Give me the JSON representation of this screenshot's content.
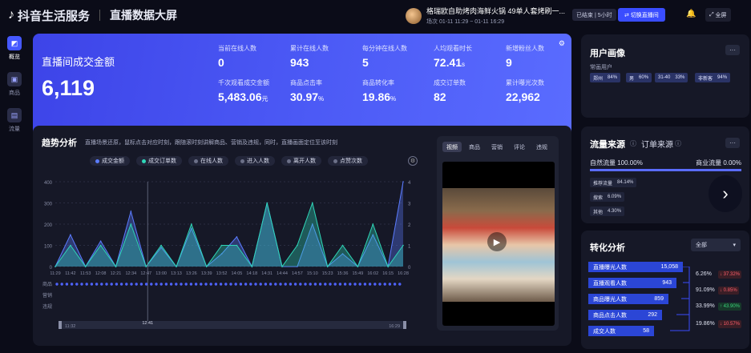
{
  "app": {
    "name": "抖音生活服务",
    "page_title": "直播数据大屏"
  },
  "room": {
    "name": "格瑞欧自助烤肉海鲜火锅 49单人套烤刷一...",
    "time": "场次 01-11 11:29 ~ 01-11 16:29"
  },
  "header": {
    "status": "已结束 | 5小时",
    "switch_label": "切换直播间",
    "fullscreen_label": "全屏"
  },
  "sidebar": {
    "items": [
      {
        "label": "概览",
        "icon": "chart-icon"
      },
      {
        "label": "商品",
        "icon": "bag-icon"
      },
      {
        "label": "流量",
        "icon": "flow-icon"
      }
    ]
  },
  "kpi": {
    "main_label": "直播间成交金额",
    "main_value": "6,119",
    "cells": [
      {
        "label": "当前在线人数",
        "value": "0",
        "unit": ""
      },
      {
        "label": "累计在线人数",
        "value": "943",
        "unit": ""
      },
      {
        "label": "每分钟在线人数",
        "value": "5",
        "unit": ""
      },
      {
        "label": "人均观看时长",
        "value": "72.41",
        "unit": "s"
      },
      {
        "label": "新增粉丝人数",
        "value": "9",
        "unit": ""
      },
      {
        "label": "千次观看成交金额",
        "value": "5,483.06",
        "unit": "元"
      },
      {
        "label": "商品点击率",
        "value": "30.97",
        "unit": "%"
      },
      {
        "label": "商品转化率",
        "value": "19.86",
        "unit": "%"
      },
      {
        "label": "成交订单数",
        "value": "82",
        "unit": ""
      },
      {
        "label": "累计曝光次数",
        "value": "22,962",
        "unit": ""
      }
    ]
  },
  "trend": {
    "title": "趋势分析",
    "desc": "直播场景还原，鼠标点击对应时刻，跟随滚时刻讲解商品、营销及违规，同时，直播画面定位至该时刻",
    "legend": [
      "成交金额",
      "成交订单数",
      "在线人数",
      "进入人数",
      "离开人数",
      "点赞次数"
    ],
    "row_labels": [
      "商品",
      "营销",
      "违规"
    ],
    "scrub_start": "11:32",
    "scrub_mid": "12:41",
    "scrub_end": "16:29"
  },
  "chart_data": {
    "type": "line",
    "x": [
      "11:29",
      "11:42",
      "11:53",
      "12:08",
      "12:21",
      "12:34",
      "12:47",
      "13:00",
      "13:13",
      "13:26",
      "13:39",
      "13:52",
      "14:05",
      "14:18",
      "14:31",
      "14:44",
      "14:57",
      "15:10",
      "15:23",
      "15:36",
      "15:49",
      "16:02",
      "16:15",
      "16:28"
    ],
    "y_left_ticks": [
      0,
      100,
      200,
      300,
      400
    ],
    "y_right_ticks": [
      0,
      1,
      2,
      3,
      4
    ],
    "series": [
      {
        "name": "成交金额",
        "color": "#5b7cff",
        "values": [
          0,
          150,
          0,
          120,
          0,
          260,
          0,
          90,
          0,
          180,
          0,
          60,
          140,
          0,
          300,
          0,
          0,
          200,
          0,
          60,
          0,
          150,
          0,
          400
        ]
      },
      {
        "name": "成交订单数",
        "color": "#2fd6b8",
        "values": [
          0,
          1,
          0,
          1,
          0,
          2,
          0,
          1,
          0,
          2,
          0,
          1,
          1,
          0,
          3,
          0,
          1,
          3,
          0,
          1,
          0,
          2,
          0,
          1
        ]
      }
    ]
  },
  "video": {
    "tabs": [
      "视频",
      "商品",
      "营销",
      "评论",
      "违规"
    ],
    "active": 0
  },
  "user_profile": {
    "title": "用户画像",
    "subtitle": "常画用户",
    "tags": [
      {
        "label": "郑州",
        "value": "84%"
      },
      {
        "label": "男",
        "value": "60%"
      },
      {
        "label": "31-40",
        "value": "33%"
      },
      {
        "label": "非新客",
        "value": "94%"
      }
    ]
  },
  "traffic": {
    "title": "流量来源",
    "subtitle": "订单来源",
    "left_label": "自然流量 100.00%",
    "right_label": "商业流量 0.00%",
    "natural_fraction": 1.0,
    "rows": [
      {
        "label": "推荐流量",
        "value": "84.14%"
      },
      {
        "label": "搜索",
        "value": "6.09%"
      },
      {
        "label": "其他",
        "value": "4.30%"
      }
    ]
  },
  "conversion": {
    "title": "转化分析",
    "filter": "全部",
    "steps": [
      {
        "label": "直播曝光人数",
        "value": "15,058"
      },
      {
        "label": "直播观看人数",
        "value": "943"
      },
      {
        "label": "商品曝光人数",
        "value": "859"
      },
      {
        "label": "商品点击人数",
        "value": "292"
      },
      {
        "label": "成交人数",
        "value": "58"
      }
    ],
    "rates": [
      {
        "rate": "6.26%",
        "change": "↓ 37.32%",
        "dir": "down"
      },
      {
        "rate": "91.09%",
        "change": "↓ 0.85%",
        "dir": "down"
      },
      {
        "rate": "33.99%",
        "change": "↑ 43.90%",
        "dir": "up"
      },
      {
        "rate": "19.86%",
        "change": "↓ 10.57%",
        "dir": "down"
      }
    ]
  }
}
